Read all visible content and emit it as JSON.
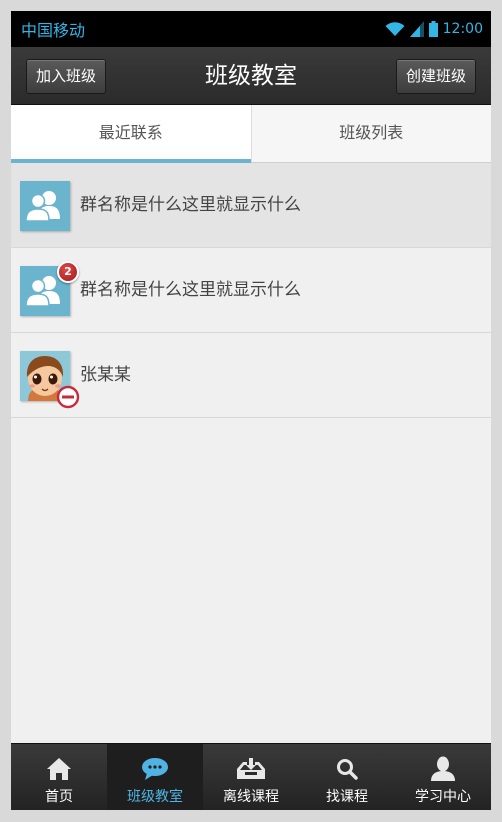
{
  "status_bar": {
    "carrier": "中国移动",
    "time": "12:00",
    "accent": "#33b5e5"
  },
  "header": {
    "title": "班级教室",
    "left_button": "加入班级",
    "right_button": "创建班级"
  },
  "tabs": [
    {
      "label": "最近联系",
      "active": true
    },
    {
      "label": "班级列表",
      "active": false
    }
  ],
  "list": [
    {
      "name": "群名称是什么这里就显示什么",
      "avatar": "group-icon",
      "badge": null,
      "selected": true
    },
    {
      "name": "群名称是什么这里就显示什么",
      "avatar": "group-icon",
      "badge": "2",
      "selected": false
    },
    {
      "name": "张某某",
      "avatar": "person-avatar",
      "status": "no-entry-icon",
      "selected": false
    }
  ],
  "bottom_nav": [
    {
      "label": "首页",
      "icon": "home-icon",
      "active": false
    },
    {
      "label": "班级教室",
      "icon": "chat-bubble-icon",
      "active": true
    },
    {
      "label": "离线课程",
      "icon": "download-tray-icon",
      "active": false
    },
    {
      "label": "找课程",
      "icon": "search-icon",
      "active": false
    },
    {
      "label": "学习中心",
      "icon": "user-icon",
      "active": false
    }
  ],
  "colors": {
    "tab_indicator": "#6bb4cf",
    "avatar_bg": "#6ab4cd",
    "badge": "#c62828",
    "nav_active": "#4fb3e3"
  }
}
